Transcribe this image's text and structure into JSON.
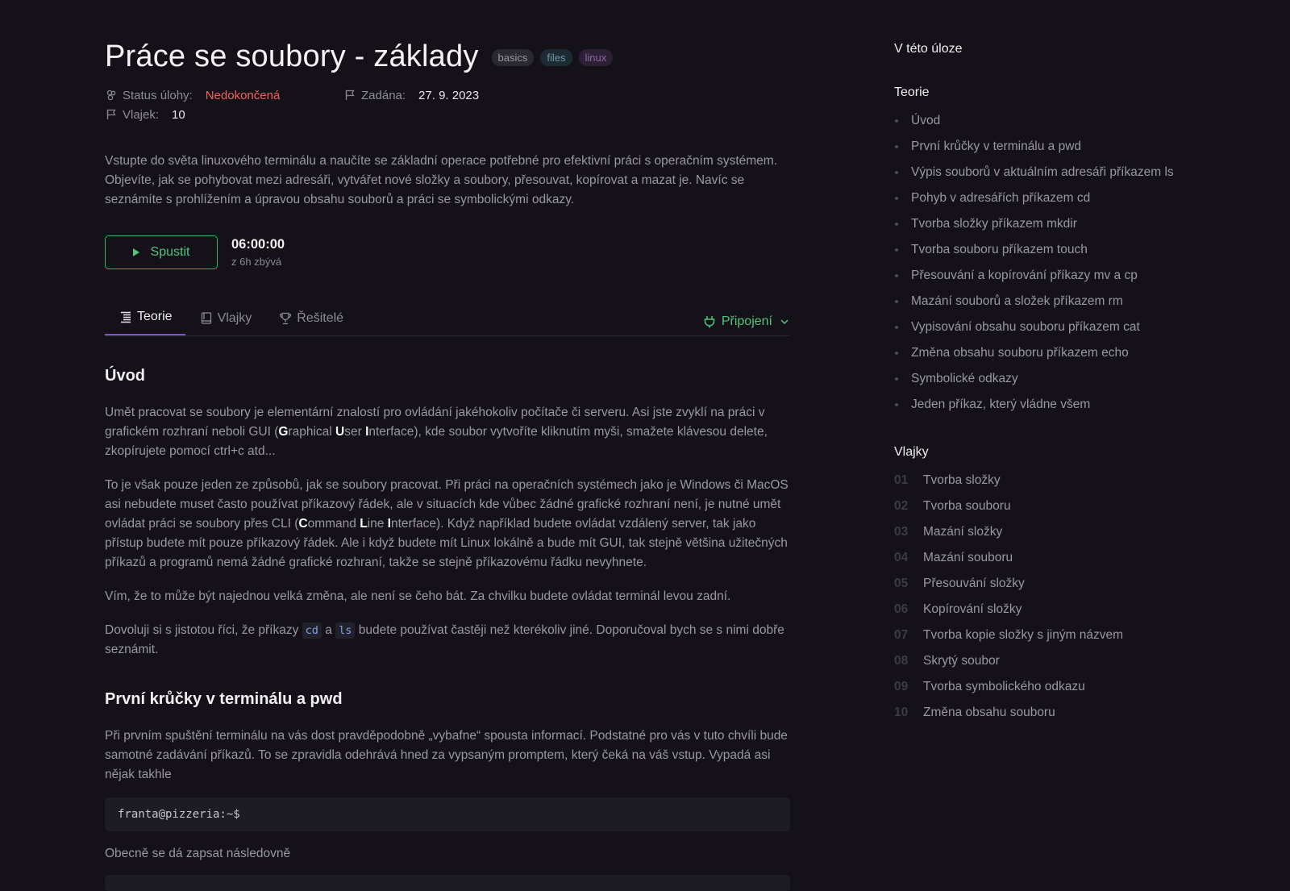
{
  "header": {
    "title": "Práce se soubory - základy",
    "tags": [
      "basics",
      "files",
      "linux"
    ]
  },
  "meta": {
    "status_label": "Status úlohy:",
    "status_value": "Nedokončená",
    "assigned_label": "Zadána:",
    "assigned_value": "27. 9. 2023",
    "flags_label": "Vlajek:",
    "flags_value": "10"
  },
  "description": "Vstupte do světa linuxového terminálu a naučíte se základní operace potřebné pro efektivní práci s operačním systémem. Objevíte, jak se pohybovat mezi adresáři, vytvářet nové složky a soubory, přesouvat, kopírovat a mazat je. Navíc se seznámíte s prohlížením a úpravou obsahu souborů a práci se symbolickými odkazy.",
  "run": {
    "button_label": "Spustit",
    "timer": "06:00:00",
    "timer_sub": "z 6h zbývá"
  },
  "tabs": [
    {
      "label": "Teorie",
      "icon": "list-icon",
      "active": true
    },
    {
      "label": "Vlajky",
      "icon": "book-icon",
      "active": false
    },
    {
      "label": "Řešitelé",
      "icon": "trophy-icon",
      "active": false
    }
  ],
  "connection": {
    "label": "Připojení",
    "icon": "plug-icon"
  },
  "content": {
    "h_intro": "Úvod",
    "p1": {
      "a": "Umět pracovat se soubory je elementární znalostí pro ovládání jakéhokoliv počítače či serveru. Asi jste zvyklí na práci v grafickém rozhraní neboli GUI (",
      "g": "G",
      "g_rest": "raphical ",
      "u": "U",
      "u_rest": "ser ",
      "i": "I",
      "i_rest": "nterface",
      "b": "), kde soubor vytvoříte kliknutím myši, smažete klávesou delete, zkopírujete pomocí ctrl+c atd..."
    },
    "p2": {
      "a": "To je však pouze jeden ze způsobů, jak se soubory pracovat. Při práci na operačních systémech jako je Windows či MacOS asi nebudete muset často používat příkazový řádek, ale v situacích kde vůbec žádné grafické rozhraní není, je nutné umět ovládat práci se soubory přes CLI (",
      "c": "C",
      "c_rest": "ommand ",
      "l": "L",
      "l_rest": "ine ",
      "i": "I",
      "i_rest": "nterface",
      "b": "). Když například budete ovládat vzdálený server, tak jako přístup budete mít pouze příkazový řádek. Ale i když budete mít Linux lokálně a bude mít GUI, tak stejně většina užitečných příkazů a programů nemá žádné grafické rozhraní, takže se stejně příkazovému řádku nevyhnete."
    },
    "p3": "Vím, že to může být najednou velká změna, ale není se čeho bát. Za chvilku budete ovládat terminál levou zadní.",
    "p4": {
      "a": "Dovoluji si s jistotou říci, že příkazy ",
      "code1": "cd",
      "mid": " a ",
      "code2": "ls",
      "b": " budete používat častěji než kterékoliv jiné. Doporučoval bych se s nimi dobře seznámit."
    },
    "h_pwd": "První krůčky v terminálu a pwd",
    "p5": "Při prvním spuštění terminálu na vás dost pravděpodobně „vybafne“ spousta informací. Podstatné pro vás v tuto chvíli bude samotné zadávání příkazů. To se zpravidla odehrává hned za vypsaným promptem, který čeká na váš vstup. Vypadá asi nějak takhle",
    "code_prompt": "franta@pizzeria:~$",
    "p6": "Obecně se dá zapsat následovně"
  },
  "sidebar": {
    "title": "V této úloze",
    "theory_heading": "Teorie",
    "theory_items": [
      "Úvod",
      "První krůčky v terminálu a pwd",
      "Výpis souborů v aktuálním adresáři příkazem ls",
      "Pohyb v adresářích příkazem cd",
      "Tvorba složky příkazem mkdir",
      "Tvorba souboru příkazem touch",
      "Přesouvání a kopírování příkazy mv a cp",
      "Mazání souborů a složek příkazem rm",
      "Vypisování obsahu souboru příkazem cat",
      "Změna obsahu souboru příkazem echo",
      "Symbolické odkazy",
      "Jeden příkaz, který vládne všem"
    ],
    "flags_heading": "Vlajky",
    "flags": [
      {
        "num": "01",
        "label": "Tvorba složky"
      },
      {
        "num": "02",
        "label": "Tvorba souboru"
      },
      {
        "num": "03",
        "label": "Mazání složky"
      },
      {
        "num": "04",
        "label": "Mazání souboru"
      },
      {
        "num": "05",
        "label": "Přesouvání složky"
      },
      {
        "num": "06",
        "label": "Kopírování složky"
      },
      {
        "num": "07",
        "label": "Tvorba kopie složky s jiným názvem"
      },
      {
        "num": "08",
        "label": "Skrytý soubor"
      },
      {
        "num": "09",
        "label": "Tvorba symbolického odkazu"
      },
      {
        "num": "10",
        "label": "Změna obsahu souboru"
      }
    ]
  },
  "colors": {
    "background": "#141218",
    "accent_green": "#52c47c",
    "status_red": "#f0625f",
    "tab_underline": "#7b54c6"
  }
}
